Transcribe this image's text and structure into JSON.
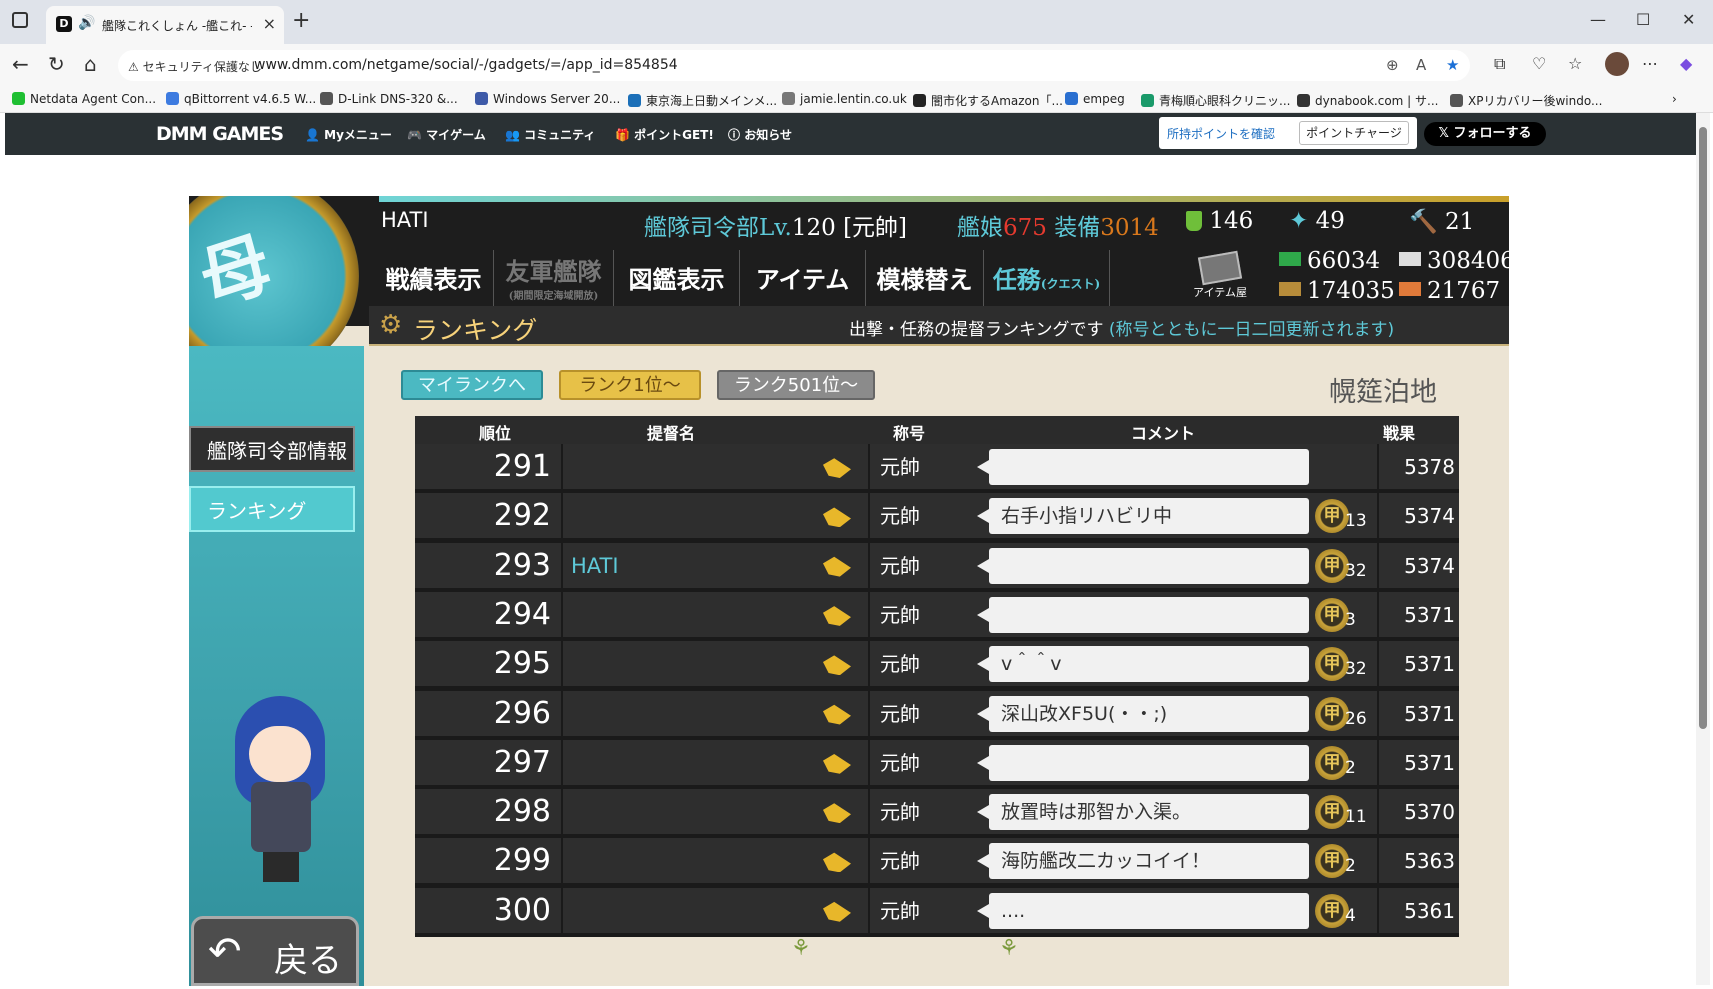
{
  "browser": {
    "tab_title": "艦隊これくしょん -艦これ- - オンラインゲーム - DMM GAMES",
    "security_label": "セキュリティ保護なし",
    "url": "www.dmm.com/netgame/social/-/gadgets/=/app_id=854854",
    "bookmarks": [
      {
        "label": "Netdata Agent Con...",
        "color": "#1fbf32"
      },
      {
        "label": "qBittorrent v4.6.5 W...",
        "color": "#3d7be0"
      },
      {
        "label": "D-Link DNS-320 &...",
        "color": "#555555"
      },
      {
        "label": "Windows Server 20...",
        "color": "#3e5aa8"
      },
      {
        "label": "東京海上日動メインメ...",
        "color": "#1b6fb8"
      },
      {
        "label": "jamie.lentin.co.uk",
        "color": "#777777"
      },
      {
        "label": "闇市化するAmazon「...",
        "color": "#222222"
      },
      {
        "label": "empeg",
        "color": "#2a6fd0"
      },
      {
        "label": "青梅順心眼科クリニッ...",
        "color": "#1a9a6a"
      },
      {
        "label": "dynabook.com | サ...",
        "color": "#333333"
      },
      {
        "label": "XPリカバリー後windo...",
        "color": "#555555"
      }
    ]
  },
  "dmm": {
    "logo": "DMM GAMES",
    "nav": [
      "Myメニュー",
      "マイゲーム",
      "コミュニティ",
      "ポイントGET!",
      "お知らせ"
    ],
    "point_check": "所持ポイントを確認",
    "point_charge": "ポイントチャージ",
    "follow": "フォローする"
  },
  "game": {
    "player_name": "HATI",
    "hq_label": "艦隊司令部Lv.",
    "hq_level": "120",
    "rank_title": "[元帥]",
    "ships_label": "艦娘",
    "ships": "675",
    "equip_label": "装備",
    "equip": "3014",
    "buckets": "146",
    "dev_materials": "49",
    "screws": "21",
    "menu": {
      "record": "戦績表示",
      "friend_fleet": "友軍艦隊",
      "friend_fleet_sub": "(期間限定海域開放)",
      "library": "図鑑表示",
      "item": "アイテム",
      "remodel": "模様替え",
      "quest": "任務",
      "quest_sub": "(クエスト)",
      "item_shop": "アイテム屋"
    },
    "resources": {
      "fuel": "66034",
      "ammo": "308406",
      "steel": "174035",
      "bauxite": "21767"
    },
    "banner_title": "ランキング",
    "banner_desc": "出撃・任務の提督ランキングです",
    "banner_note": "(称号とともに一日二回更新されます)",
    "sidebar": {
      "info": "艦隊司令部情報",
      "ranking": "ランキング"
    },
    "rank_buttons": {
      "my": "マイランクへ",
      "top": "ランク1位〜",
      "r501": "ランク501位〜"
    },
    "base_name": "幌筵泊地",
    "back": "戻る",
    "headers": {
      "rank": "順位",
      "admiral": "提督名",
      "title": "称号",
      "comment": "コメント",
      "result": "戦果"
    },
    "rows": [
      {
        "rank": "291",
        "admiral": "",
        "title": "元帥",
        "comment": "",
        "medals": "",
        "result": "5378"
      },
      {
        "rank": "292",
        "admiral": "",
        "title": "元帥",
        "comment": "右手小指リハビリ中",
        "medals": "13",
        "result": "5374"
      },
      {
        "rank": "293",
        "admiral": "HATI",
        "title": "元帥",
        "comment": "",
        "medals": "32",
        "result": "5374"
      },
      {
        "rank": "294",
        "admiral": "",
        "title": "元帥",
        "comment": "",
        "medals": "3",
        "result": "5371"
      },
      {
        "rank": "295",
        "admiral": "",
        "title": "元帥",
        "comment": "v＾＾v",
        "medals": "32",
        "result": "5371"
      },
      {
        "rank": "296",
        "admiral": "",
        "title": "元帥",
        "comment": "深山改XF5U(・・;)",
        "medals": "26",
        "result": "5371"
      },
      {
        "rank": "297",
        "admiral": "",
        "title": "元帥",
        "comment": "",
        "medals": "2",
        "result": "5371"
      },
      {
        "rank": "298",
        "admiral": "",
        "title": "元帥",
        "comment": "放置時は那智か入渠。",
        "medals": "11",
        "result": "5370"
      },
      {
        "rank": "299",
        "admiral": "",
        "title": "元帥",
        "comment": "海防艦改二カッコイイ！",
        "medals": "2",
        "result": "5363"
      },
      {
        "rank": "300",
        "admiral": "",
        "title": "元帥",
        "comment": "....",
        "medals": "4",
        "result": "5361"
      }
    ]
  }
}
